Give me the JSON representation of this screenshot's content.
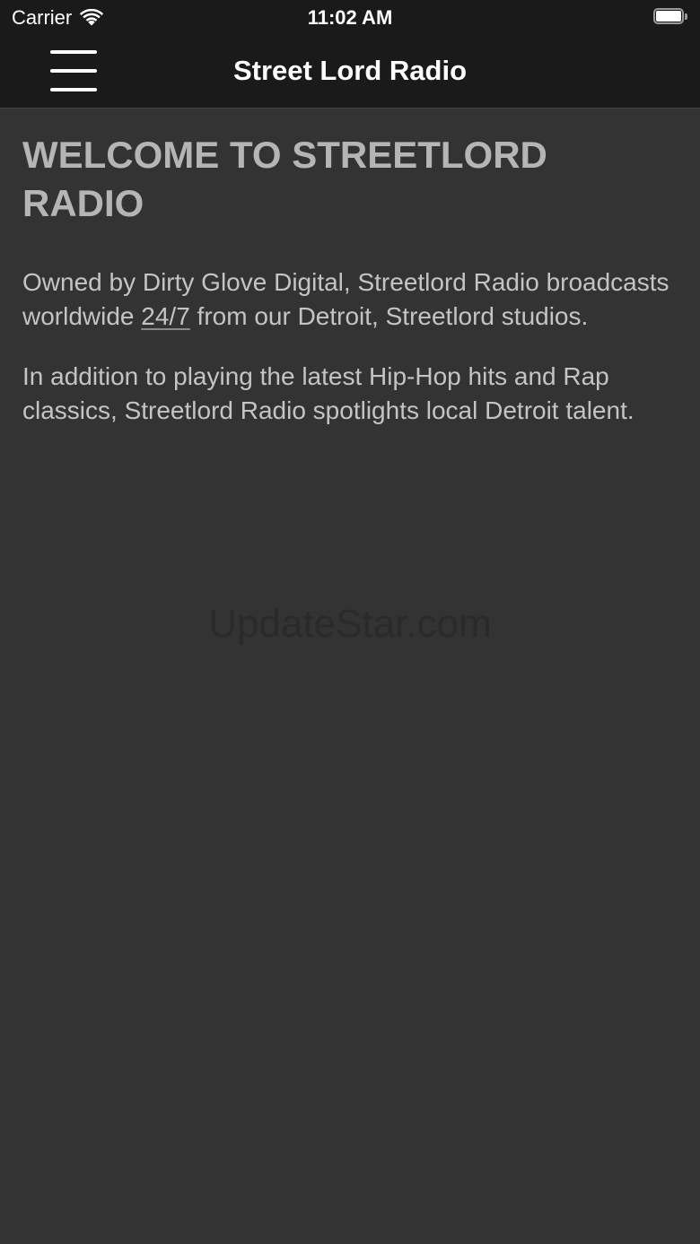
{
  "status_bar": {
    "carrier": "Carrier",
    "time": "11:02 AM"
  },
  "nav": {
    "title": "Street Lord Radio",
    "menu_icon": "hamburger-menu-icon"
  },
  "content": {
    "heading": "WELCOME TO STREETLORD RADIO",
    "para1_before": "Owned by Dirty Glove Digital, Streetlord Radio broadcasts worldwide ",
    "para1_link": "24/7",
    "para1_after": " from our Detroit, Streetlord studios.",
    "para2": "In addition to playing the latest Hip-Hop hits and Rap classics, Streetlord Radio spotlights local Detroit talent."
  },
  "watermark": "UpdateStar.com",
  "colors": {
    "background": "#333333",
    "bar_background": "#1a1a1a",
    "heading": "#b5b5b5",
    "body_text": "#c4c4c4"
  }
}
